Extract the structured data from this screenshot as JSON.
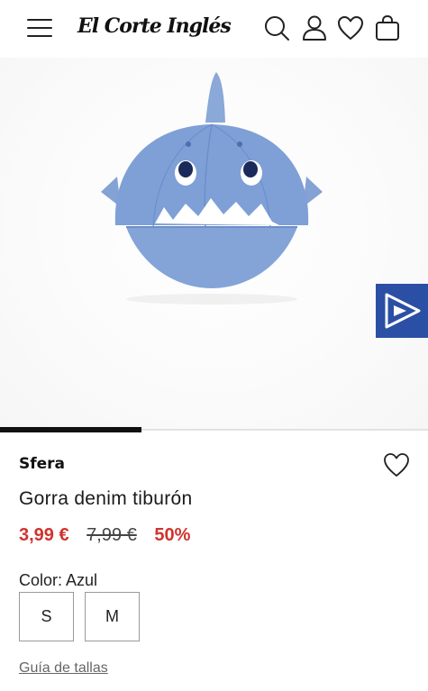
{
  "header": {
    "logo": "El Corte Inglés",
    "icons": [
      "menu-icon",
      "search-icon",
      "user-icon",
      "heart-icon",
      "bag-icon"
    ]
  },
  "gallery": {
    "image_description": "shark-cap-image",
    "progress": 0.33
  },
  "product": {
    "brand": "Sfera",
    "title": "Gorra denim tiburón",
    "price_current": "3,99 €",
    "price_old": "7,99 €",
    "discount": "50%",
    "color_label": "Color: Azul",
    "sizes": [
      "S",
      "M"
    ],
    "size_guide": "Guía de tallas"
  },
  "colors": {
    "sale": "#d0332e",
    "badge": "#2b4fa5",
    "denim": "#7fa0d6"
  }
}
